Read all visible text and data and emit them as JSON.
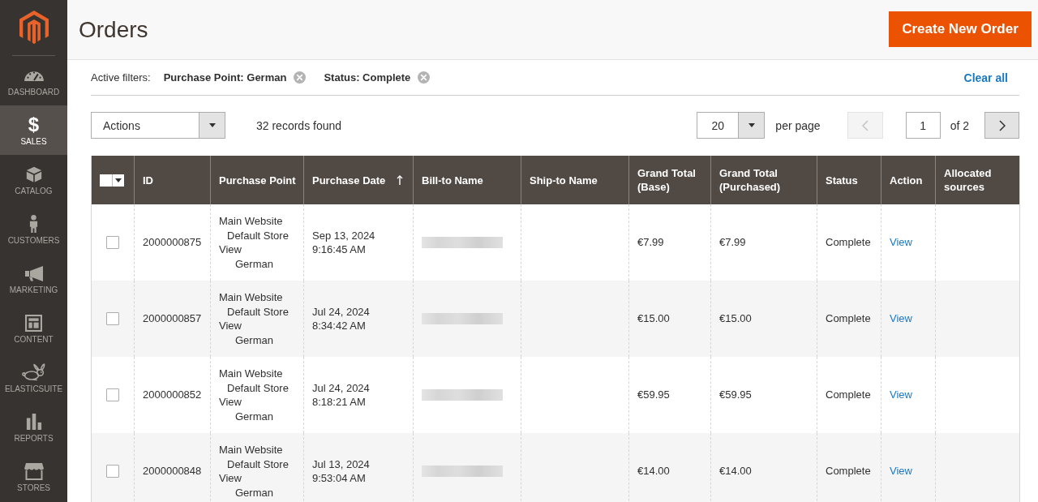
{
  "sidebar": {
    "items": [
      {
        "label": "DASHBOARD",
        "selected": false
      },
      {
        "label": "SALES",
        "glyph": "$",
        "selected": true
      },
      {
        "label": "CATALOG",
        "selected": false
      },
      {
        "label": "CUSTOMERS",
        "selected": false
      },
      {
        "label": "MARKETING",
        "selected": false
      },
      {
        "label": "CONTENT",
        "selected": false
      },
      {
        "label": "ELASTICSUITE",
        "selected": false
      },
      {
        "label": "REPORTS",
        "selected": false
      },
      {
        "label": "STORES",
        "selected": false
      }
    ]
  },
  "header": {
    "title": "Orders",
    "button": "Create New Order"
  },
  "filters": {
    "label": "Active filters:",
    "items": [
      "Purchase Point: German",
      "Status: Complete"
    ],
    "clear_all": "Clear all"
  },
  "toolbar": {
    "actions": "Actions",
    "records": "32 records found",
    "per_page": {
      "value": "20",
      "label": "per page"
    },
    "pager": {
      "prev": {
        "disabled": true
      },
      "page": "1",
      "total": "of 2",
      "next": {
        "disabled": false
      }
    }
  },
  "table": {
    "columns": [
      {
        "label": "ID",
        "sorted": false
      },
      {
        "label": "Purchase Point",
        "sorted": false
      },
      {
        "label": "Purchase Date",
        "sorted": true
      },
      {
        "label": "Bill-to Name",
        "sorted": false
      },
      {
        "label": "Ship-to Name",
        "sorted": false
      },
      {
        "label": "Grand Total (Base)",
        "sorted": false
      },
      {
        "label": "Grand Total (Purchased)",
        "sorted": false
      },
      {
        "label": "Status",
        "sorted": false
      },
      {
        "label": "Action",
        "sorted": false
      },
      {
        "label": "Allocated sources",
        "sorted": false
      }
    ],
    "rows": [
      {
        "selected": false,
        "id": "2000000875",
        "purchase_point": [
          "Main Website",
          "Default Store View",
          "German"
        ],
        "purchase_date": "Sep 13, 2024 9:16:45 AM",
        "bill_to_blurred": true,
        "grand_total_base": "€7.99",
        "grand_total_purchased": "€7.99",
        "status": "Complete",
        "action": "View"
      },
      {
        "selected": false,
        "id": "2000000857",
        "purchase_point": [
          "Main Website",
          "Default Store View",
          "German"
        ],
        "purchase_date": "Jul 24, 2024 8:34:42 AM",
        "bill_to_blurred": true,
        "grand_total_base": "€15.00",
        "grand_total_purchased": "€15.00",
        "status": "Complete",
        "action": "View"
      },
      {
        "selected": false,
        "id": "2000000852",
        "purchase_point": [
          "Main Website",
          "Default Store View",
          "German"
        ],
        "purchase_date": "Jul 24, 2024 8:18:21 AM",
        "bill_to_blurred": true,
        "grand_total_base": "€59.95",
        "grand_total_purchased": "€59.95",
        "status": "Complete",
        "action": "View"
      },
      {
        "selected": false,
        "id": "2000000848",
        "purchase_point": [
          "Main Website",
          "Default Store View",
          "German"
        ],
        "purchase_date": "Jul 13, 2024 9:53:04 AM",
        "bill_to_blurred": true,
        "grand_total_base": "€14.00",
        "grand_total_purchased": "€14.00",
        "status": "Complete",
        "action": "View"
      }
    ]
  }
}
